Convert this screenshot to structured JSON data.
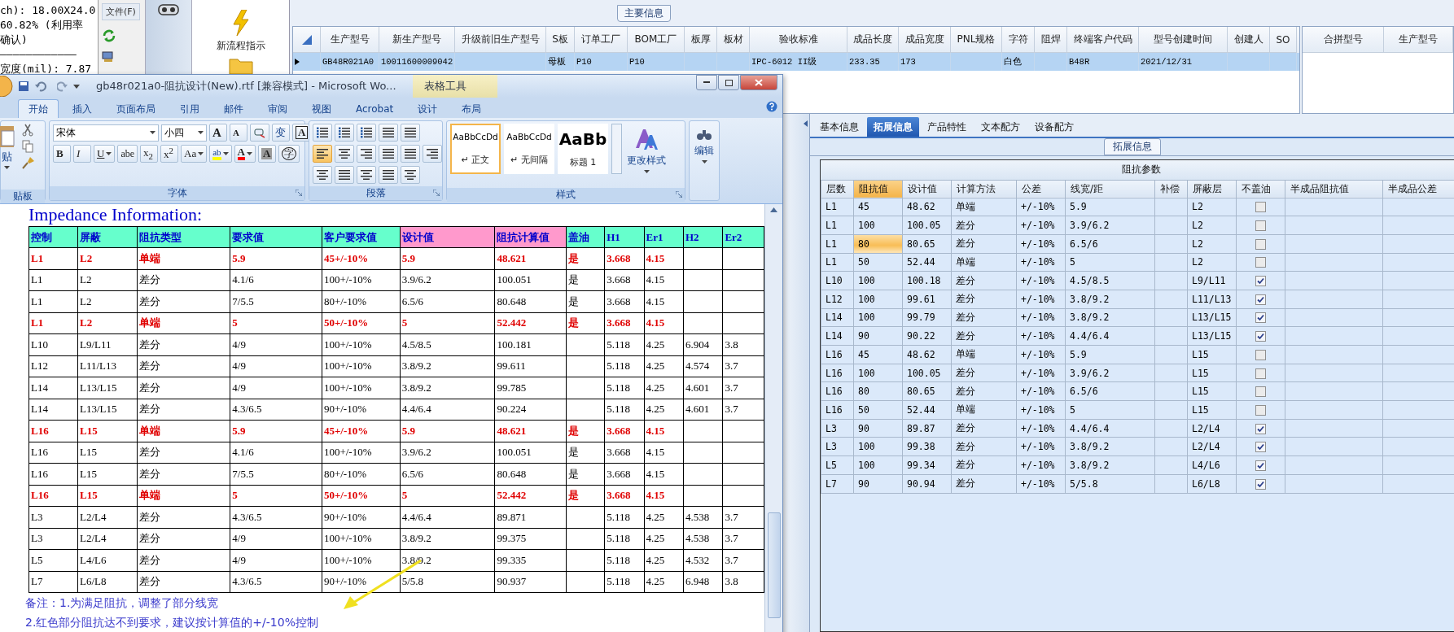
{
  "terminal": {
    "lines": [
      "ch): 18.00X24.0",
      "60.82% (利用率",
      "确认)",
      "————————————",
      "宽度(mil): 7.87"
    ]
  },
  "file_menu": {
    "label": "文件(F)"
  },
  "toolbox": {
    "items": [
      {
        "label": "新流程指示"
      }
    ]
  },
  "main_info": {
    "title": "主要信息",
    "columns": [
      "生产型号",
      "新生产型号",
      "升级前旧生产型号",
      "S板",
      "订单工厂",
      "BOM工厂",
      "板厚",
      "板材",
      "验收标准",
      "成品长度",
      "成品宽度",
      "PNL规格",
      "字符",
      "阻焊",
      "终端客户代码",
      "型号创建时间",
      "创建人",
      "SO"
    ],
    "rows": [
      {
        "selected": true,
        "cells": [
          "GB48R021A0",
          "10011600009042",
          "",
          "母板",
          "P10",
          "P10",
          "",
          "",
          "IPC-6012 II级",
          "233.35",
          "173",
          "",
          "白色",
          "",
          "B48R",
          "2021/12/31",
          "",
          ""
        ]
      }
    ],
    "merge_columns": [
      "合拼型号",
      "生产型号"
    ]
  },
  "word": {
    "title": "gb48r021a0-阻抗设计(New).rtf [兼容模式] - Microsoft Wo...",
    "context_title": "表格工具",
    "tabs": [
      {
        "label": "开始",
        "selected": true
      },
      {
        "label": "插入",
        "selected": false
      },
      {
        "label": "页面布局",
        "selected": false
      },
      {
        "label": "引用",
        "selected": false
      },
      {
        "label": "邮件",
        "selected": false
      },
      {
        "label": "审阅",
        "selected": false
      },
      {
        "label": "视图",
        "selected": false
      },
      {
        "label": "Acrobat",
        "selected": false
      },
      {
        "label": "设计",
        "selected": false
      },
      {
        "label": "布局",
        "selected": false
      }
    ],
    "clipboard": {
      "paste_label": "贴",
      "group_label": "贴板"
    },
    "font": {
      "name": "宋体",
      "size": "小四",
      "group_label": "字体",
      "row1": [
        {
          "kind": "grow",
          "label": "A"
        },
        {
          "kind": "shrink",
          "label": "A"
        },
        {
          "kind": "clear"
        },
        {
          "kind": "phonetic",
          "label": "变"
        },
        {
          "kind": "boxed",
          "label": "A"
        }
      ],
      "row2": [
        {
          "kind": "bold",
          "label": "B",
          "menu": false
        },
        {
          "kind": "italic",
          "label": "I",
          "menu": false
        },
        {
          "kind": "underline",
          "label": "U",
          "menu": true
        },
        {
          "kind": "strike",
          "label": "abe",
          "menu": false
        },
        {
          "kind": "plain",
          "label": "x$_{2}$",
          "menu": false
        },
        {
          "kind": "plain",
          "label": "x$^{2}$",
          "menu": false
        },
        {
          "kind": "plain",
          "label": "Aa",
          "menu": true
        },
        {
          "kind": "highlight",
          "label": "ab",
          "menu": true
        },
        {
          "kind": "color",
          "label": "A",
          "menu": true
        },
        {
          "kind": "shade",
          "label": "A",
          "menu": false
        },
        {
          "kind": "circle",
          "label": "字",
          "menu": false
        }
      ]
    },
    "paragraph": {
      "group_label": "段落",
      "alignments": [
        {
          "selected": true
        },
        {
          "selected": false
        },
        {
          "selected": false
        },
        {
          "selected": false
        },
        {
          "selected": false
        }
      ]
    },
    "styles": {
      "group_label": "样式",
      "items": [
        {
          "sample": "AaBbCcDd",
          "name": "↵ 正文",
          "selected": true
        },
        {
          "sample": "AaBbCcDd",
          "name": "↵ 无间隔",
          "selected": false
        },
        {
          "sample": "AaBb",
          "name": "标题 1",
          "selected": false
        }
      ],
      "change_label": "更改样式"
    },
    "editing": {
      "label": "编辑"
    },
    "document": {
      "heading": "Impedance Information:",
      "columns": [
        {
          "label": "控制",
          "color": "#66ffcc"
        },
        {
          "label": "屏蔽",
          "color": "#66ffcc"
        },
        {
          "label": "阻抗类型",
          "color": "#66ffcc"
        },
        {
          "label": "要求值",
          "color": "#66ffcc"
        },
        {
          "label": "客户要求值",
          "color": "#66ffcc"
        },
        {
          "label": "设计值",
          "color": "#ff99cc"
        },
        {
          "label": "阻抗计算值",
          "color": "#ff99cc"
        },
        {
          "label": "盖油",
          "color": "#66ffcc"
        },
        {
          "label": "H1",
          "color": "#66ffcc"
        },
        {
          "label": "Er1",
          "color": "#66ffcc"
        },
        {
          "label": "H2",
          "color": "#66ffcc"
        },
        {
          "label": "Er2",
          "color": "#66ffcc"
        }
      ],
      "rows": [
        {
          "kind": "warning",
          "cells": [
            "L1",
            "L2",
            "单端",
            "5.9",
            "45+/-10%",
            "5.9",
            "48.621",
            "是",
            "3.668",
            "4.15",
            "",
            ""
          ]
        },
        {
          "kind": "normal",
          "cells": [
            "L1",
            "L2",
            "差分",
            "4.1/6",
            "100+/-10%",
            "3.9/6.2",
            "100.051",
            "是",
            "3.668",
            "4.15",
            "",
            ""
          ]
        },
        {
          "kind": "normal",
          "cells": [
            "L1",
            "L2",
            "差分",
            "7/5.5",
            "80+/-10%",
            "6.5/6",
            "80.648",
            "是",
            "3.668",
            "4.15",
            "",
            ""
          ]
        },
        {
          "kind": "warning",
          "cells": [
            "L1",
            "L2",
            "单端",
            "5",
            "50+/-10%",
            "5",
            "52.442",
            "是",
            "3.668",
            "4.15",
            "",
            ""
          ]
        },
        {
          "kind": "normal",
          "cells": [
            "L10",
            "L9/L11",
            "差分",
            "4/9",
            "100+/-10%",
            "4.5/8.5",
            "100.181",
            "",
            "5.118",
            "4.25",
            "6.904",
            "3.8"
          ]
        },
        {
          "kind": "normal",
          "cells": [
            "L12",
            "L11/L13",
            "差分",
            "4/9",
            "100+/-10%",
            "3.8/9.2",
            "99.611",
            "",
            "5.118",
            "4.25",
            "4.574",
            "3.7"
          ]
        },
        {
          "kind": "normal",
          "cells": [
            "L14",
            "L13/L15",
            "差分",
            "4/9",
            "100+/-10%",
            "3.8/9.2",
            "99.785",
            "",
            "5.118",
            "4.25",
            "4.601",
            "3.7"
          ]
        },
        {
          "kind": "normal",
          "cells": [
            "L14",
            "L13/L15",
            "差分",
            "4.3/6.5",
            "90+/-10%",
            "4.4/6.4",
            "90.224",
            "",
            "5.118",
            "4.25",
            "4.601",
            "3.7"
          ]
        },
        {
          "kind": "warning",
          "cells": [
            "L16",
            "L15",
            "单端",
            "5.9",
            "45+/-10%",
            "5.9",
            "48.621",
            "是",
            "3.668",
            "4.15",
            "",
            ""
          ]
        },
        {
          "kind": "normal",
          "cells": [
            "L16",
            "L15",
            "差分",
            "4.1/6",
            "100+/-10%",
            "3.9/6.2",
            "100.051",
            "是",
            "3.668",
            "4.15",
            "",
            ""
          ]
        },
        {
          "kind": "normal",
          "cells": [
            "L16",
            "L15",
            "差分",
            "7/5.5",
            "80+/-10%",
            "6.5/6",
            "80.648",
            "是",
            "3.668",
            "4.15",
            "",
            ""
          ]
        },
        {
          "kind": "warning",
          "cells": [
            "L16",
            "L15",
            "单端",
            "5",
            "50+/-10%",
            "5",
            "52.442",
            "是",
            "3.668",
            "4.15",
            "",
            ""
          ]
        },
        {
          "kind": "normal",
          "cells": [
            "L3",
            "L2/L4",
            "差分",
            "4.3/6.5",
            "90+/-10%",
            "4.4/6.4",
            "89.871",
            "",
            "5.118",
            "4.25",
            "4.538",
            "3.7"
          ]
        },
        {
          "kind": "normal",
          "cells": [
            "L3",
            "L2/L4",
            "差分",
            "4/9",
            "100+/-10%",
            "3.8/9.2",
            "99.375",
            "",
            "5.118",
            "4.25",
            "4.538",
            "3.7"
          ]
        },
        {
          "kind": "normal",
          "cells": [
            "L5",
            "L4/L6",
            "差分",
            "4/9",
            "100+/-10%",
            "3.8/9.2",
            "99.335",
            "",
            "5.118",
            "4.25",
            "4.532",
            "3.7"
          ]
        },
        {
          "kind": "normal",
          "cells": [
            "L7",
            "L6/L8",
            "差分",
            "4.3/6.5",
            "90+/-10%",
            "5/5.8",
            "90.937",
            "",
            "5.118",
            "4.25",
            "6.948",
            "3.8"
          ]
        }
      ],
      "notes": [
        "备注：1.为满足阻抗，调整了部分线宽",
        "2.红色部分阻抗达不到要求，建议按计算值的+/-10%控制"
      ]
    }
  },
  "detail": {
    "tabs": [
      {
        "label": "基本信息",
        "selected": false
      },
      {
        "label": "拓展信息",
        "selected": true
      },
      {
        "label": "产品特性",
        "selected": false
      },
      {
        "label": "文本配方",
        "selected": false
      },
      {
        "label": "设备配方",
        "selected": false
      }
    ],
    "group_title": "拓展信息",
    "table_title": "阻抗参数",
    "columns": [
      {
        "label": "层数",
        "selected": false
      },
      {
        "label": "阻抗值",
        "selected": true
      },
      {
        "label": "设计值",
        "selected": false
      },
      {
        "label": "计算方法",
        "selected": false
      },
      {
        "label": "公差",
        "selected": false
      },
      {
        "label": "线宽/距",
        "selected": false
      },
      {
        "label": "补偿",
        "selected": false
      },
      {
        "label": "屏蔽层",
        "selected": false
      },
      {
        "label": "不盖油",
        "selected": false
      },
      {
        "label": "半成品阻抗值",
        "selected": false
      },
      {
        "label": "半成品公差",
        "selected": false
      }
    ],
    "rows": [
      {
        "selected": false,
        "cells": [
          "L1",
          "45",
          "48.62",
          "单端",
          "+/-10%",
          "5.9",
          "",
          "L2"
        ],
        "no_oil": false
      },
      {
        "selected": false,
        "cells": [
          "L1",
          "100",
          "100.05",
          "差分",
          "+/-10%",
          "3.9/6.2",
          "",
          "L2"
        ],
        "no_oil": false
      },
      {
        "selected": true,
        "cells": [
          "L1",
          "80",
          "80.65",
          "差分",
          "+/-10%",
          "6.5/6",
          "",
          "L2"
        ],
        "no_oil": false
      },
      {
        "selected": false,
        "cells": [
          "L1",
          "50",
          "52.44",
          "单端",
          "+/-10%",
          "5",
          "",
          "L2"
        ],
        "no_oil": false
      },
      {
        "selected": false,
        "cells": [
          "L10",
          "100",
          "100.18",
          "差分",
          "+/-10%",
          "4.5/8.5",
          "",
          "L9/L11"
        ],
        "no_oil": true
      },
      {
        "selected": false,
        "cells": [
          "L12",
          "100",
          "99.61",
          "差分",
          "+/-10%",
          "3.8/9.2",
          "",
          "L11/L13"
        ],
        "no_oil": true
      },
      {
        "selected": false,
        "cells": [
          "L14",
          "100",
          "99.79",
          "差分",
          "+/-10%",
          "3.8/9.2",
          "",
          "L13/L15"
        ],
        "no_oil": true
      },
      {
        "selected": false,
        "cells": [
          "L14",
          "90",
          "90.22",
          "差分",
          "+/-10%",
          "4.4/6.4",
          "",
          "L13/L15"
        ],
        "no_oil": true
      },
      {
        "selected": false,
        "cells": [
          "L16",
          "45",
          "48.62",
          "单端",
          "+/-10%",
          "5.9",
          "",
          "L15"
        ],
        "no_oil": false
      },
      {
        "selected": false,
        "cells": [
          "L16",
          "100",
          "100.05",
          "差分",
          "+/-10%",
          "3.9/6.2",
          "",
          "L15"
        ],
        "no_oil": false
      },
      {
        "selected": false,
        "cells": [
          "L16",
          "80",
          "80.65",
          "差分",
          "+/-10%",
          "6.5/6",
          "",
          "L15"
        ],
        "no_oil": false
      },
      {
        "selected": false,
        "cells": [
          "L16",
          "50",
          "52.44",
          "单端",
          "+/-10%",
          "5",
          "",
          "L15"
        ],
        "no_oil": false
      },
      {
        "selected": false,
        "cells": [
          "L3",
          "90",
          "89.87",
          "差分",
          "+/-10%",
          "4.4/6.4",
          "",
          "L2/L4"
        ],
        "no_oil": true
      },
      {
        "selected": false,
        "cells": [
          "L3",
          "100",
          "99.38",
          "差分",
          "+/-10%",
          "3.8/9.2",
          "",
          "L2/L4"
        ],
        "no_oil": true
      },
      {
        "selected": false,
        "cells": [
          "L5",
          "100",
          "99.34",
          "差分",
          "+/-10%",
          "3.8/9.2",
          "",
          "L4/L6"
        ],
        "no_oil": true
      },
      {
        "selected": false,
        "cells": [
          "L7",
          "90",
          "90.94",
          "差分",
          "+/-10%",
          "5/5.8",
          "",
          "L6/L8"
        ],
        "no_oil": true
      }
    ]
  }
}
